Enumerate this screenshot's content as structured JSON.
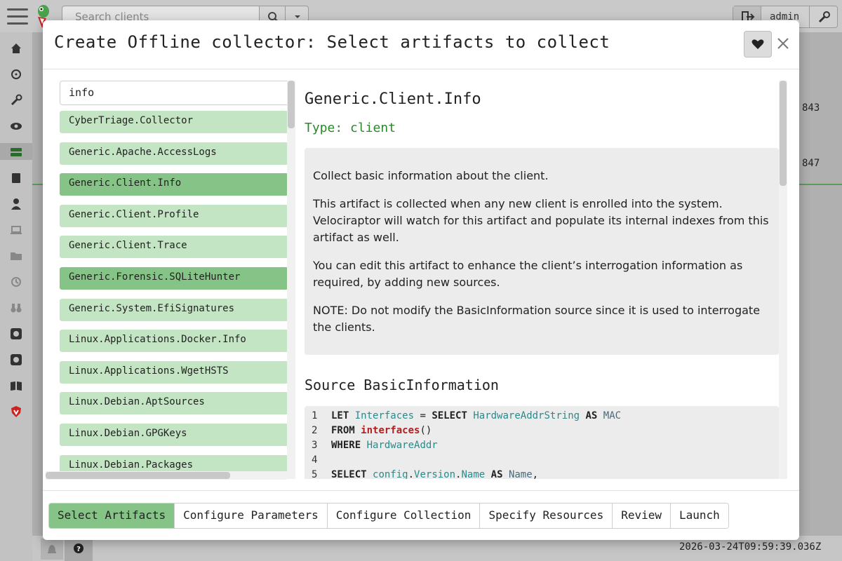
{
  "app": {
    "search_placeholder": "Search clients",
    "username": "admin",
    "bg_rows": [
      "843",
      "847"
    ],
    "timestamp": "2026-03-24T09:59:39.036Z"
  },
  "modal": {
    "title": "Create Offline collector: Select artifacts to collect",
    "filter_value": "info",
    "artifacts": [
      {
        "name": "CyberTriage.Collector",
        "selected": false
      },
      {
        "name": "Generic.Apache.AccessLogs",
        "selected": false
      },
      {
        "name": "Generic.Client.Info",
        "selected": true
      },
      {
        "name": "Generic.Client.Profile",
        "selected": false
      },
      {
        "name": "Generic.Client.Trace",
        "selected": false
      },
      {
        "name": "Generic.Forensic.SQLiteHunter",
        "selected": true
      },
      {
        "name": "Generic.System.EfiSignatures",
        "selected": false
      },
      {
        "name": "Linux.Applications.Docker.Info",
        "selected": false
      },
      {
        "name": "Linux.Applications.WgetHSTS",
        "selected": false
      },
      {
        "name": "Linux.Debian.AptSources",
        "selected": false
      },
      {
        "name": "Linux.Debian.GPGKeys",
        "selected": false
      },
      {
        "name": "Linux.Debian.Packages",
        "selected": false
      }
    ],
    "detail": {
      "name": "Generic.Client.Info",
      "type": "Type: client",
      "description": [
        "Collect basic information about the client.",
        "This artifact is collected when any new client is enrolled into the system. Velociraptor will watch for this artifact and populate its internal indexes from this artifact as well.",
        "You can edit this artifact to enhance the client’s interrogation information as required, by adding new sources.",
        "NOTE: Do not modify the BasicInformation source since it is used to interrogate the clients."
      ],
      "source_title": "Source BasicInformation",
      "code_lines": [
        "1",
        "2",
        "3",
        "4",
        "5"
      ]
    },
    "steps": [
      {
        "label": "Select Artifacts",
        "active": true
      },
      {
        "label": "Configure Parameters",
        "active": false
      },
      {
        "label": "Configure Collection",
        "active": false
      },
      {
        "label": "Specify Resources",
        "active": false
      },
      {
        "label": "Review",
        "active": false
      },
      {
        "label": "Launch",
        "active": false
      }
    ]
  },
  "colors": {
    "accent": "#86c386",
    "item_bg": "#c4e5c4",
    "type_text": "#2a8a2a"
  },
  "icons": [
    "hamburger-icon",
    "search-icon",
    "chevron-down-icon",
    "sign-out-icon",
    "wrench-icon",
    "heart-icon",
    "close-icon",
    "home-icon",
    "crosshair-icon",
    "eye-icon",
    "server-icon",
    "book-icon",
    "user-icon",
    "laptop-icon",
    "folder-icon",
    "history-icon",
    "binoculars-icon",
    "github-icon",
    "shield-icon",
    "bell-icon",
    "question-icon"
  ]
}
